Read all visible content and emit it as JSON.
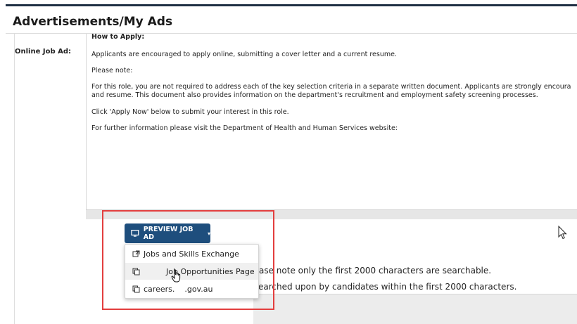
{
  "page": {
    "title": "Advertisements/My Ads"
  },
  "field": {
    "label": "Online Job Ad:"
  },
  "editor": {
    "heading": "How to Apply:",
    "lines": [
      "Applicants are encouraged to apply online, submitting a cover letter and a current resume.",
      "Please note:",
      "For this role, you are not required to address each of the key selection criteria in a separate written document. Applicants are strongly encoura",
      "and resume. This document also provides information on the department's recruitment and employment safety screening processes.",
      "Click 'Apply Now' below to submit your interest in this role.",
      "For further information please visit the Department of Health and Human Services website:"
    ]
  },
  "lower": {
    "line1": "ase note only the first 2000 characters are searchable.",
    "line2": "earched upon by candidates within the first 2000 characters."
  },
  "preview_button": {
    "label": "PREVIEW JOB AD",
    "icon": "monitor-icon",
    "caret": "▾"
  },
  "dropdown": {
    "items": [
      {
        "label": "Jobs and Skills Exchange",
        "icon": "external-link-icon"
      },
      {
        "label": "Job Opportunities Page",
        "icon": "copy-icon"
      },
      {
        "label": "careers.    .gov.au",
        "icon": "copy-icon"
      }
    ]
  },
  "colors": {
    "accent": "#1e4e7d",
    "highlight": "#e33e3e",
    "top_bar": "#1f2f44"
  }
}
